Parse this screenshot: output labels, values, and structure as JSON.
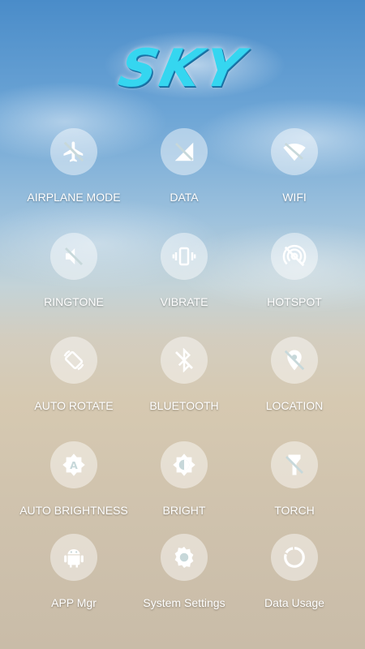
{
  "app": {
    "logo_text": "SKY"
  },
  "colors": {
    "logo": "#35d6f0",
    "icon_fill": "#ffffff",
    "circle_bg": "rgba(255,255,255,0.45)"
  },
  "toggles": [
    {
      "label": "AIRPLANE MODE",
      "icon": "airplane-off-icon"
    },
    {
      "label": "DATA",
      "icon": "mobile-data-off-icon"
    },
    {
      "label": "WIFI",
      "icon": "wifi-off-icon"
    },
    {
      "label": "RINGTONE",
      "icon": "speaker-muted-icon"
    },
    {
      "label": "VIBRATE",
      "icon": "vibrate-icon"
    },
    {
      "label": "HOTSPOT",
      "icon": "hotspot-off-icon"
    },
    {
      "label": "AUTO ROTATE",
      "icon": "rotate-icon"
    },
    {
      "label": "BLUETOOTH",
      "icon": "bluetooth-off-icon"
    },
    {
      "label": "LOCATION",
      "icon": "location-off-icon"
    },
    {
      "label": "AUTO BRIGHTNESS",
      "icon": "auto-brightness-icon"
    },
    {
      "label": "BRIGHT",
      "icon": "brightness-icon"
    },
    {
      "label": "TORCH",
      "icon": "torch-icon"
    },
    {
      "label": "APP Mgr",
      "icon": "android-icon"
    },
    {
      "label": "System Settings",
      "icon": "settings-gear-icon"
    },
    {
      "label": "Data Usage",
      "icon": "data-usage-icon"
    }
  ]
}
